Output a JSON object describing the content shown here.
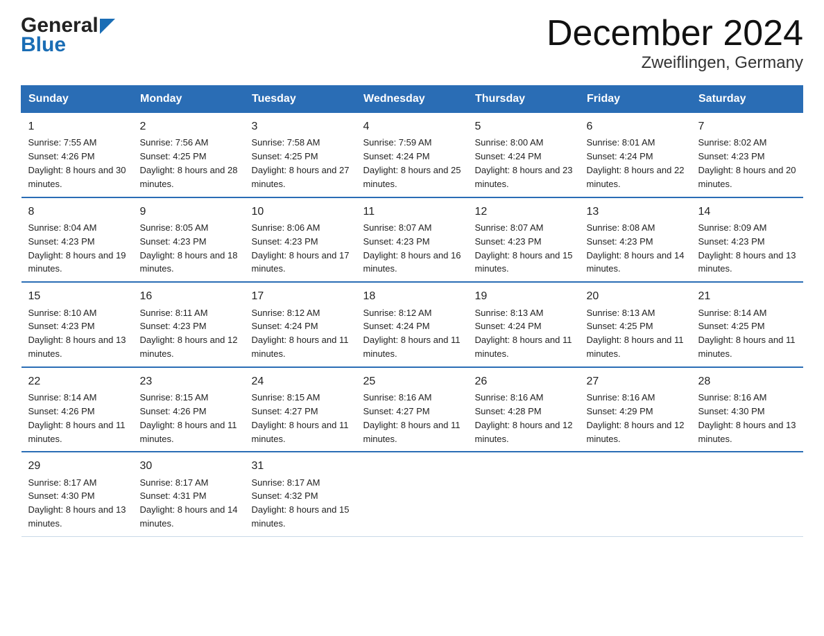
{
  "header": {
    "logo_general": "General",
    "logo_blue": "Blue",
    "title": "December 2024",
    "subtitle": "Zweiflingen, Germany"
  },
  "weekdays": [
    "Sunday",
    "Monday",
    "Tuesday",
    "Wednesday",
    "Thursday",
    "Friday",
    "Saturday"
  ],
  "weeks": [
    [
      {
        "day": "1",
        "sunrise": "7:55 AM",
        "sunset": "4:26 PM",
        "daylight": "8 hours and 30 minutes."
      },
      {
        "day": "2",
        "sunrise": "7:56 AM",
        "sunset": "4:25 PM",
        "daylight": "8 hours and 28 minutes."
      },
      {
        "day": "3",
        "sunrise": "7:58 AM",
        "sunset": "4:25 PM",
        "daylight": "8 hours and 27 minutes."
      },
      {
        "day": "4",
        "sunrise": "7:59 AM",
        "sunset": "4:24 PM",
        "daylight": "8 hours and 25 minutes."
      },
      {
        "day": "5",
        "sunrise": "8:00 AM",
        "sunset": "4:24 PM",
        "daylight": "8 hours and 23 minutes."
      },
      {
        "day": "6",
        "sunrise": "8:01 AM",
        "sunset": "4:24 PM",
        "daylight": "8 hours and 22 minutes."
      },
      {
        "day": "7",
        "sunrise": "8:02 AM",
        "sunset": "4:23 PM",
        "daylight": "8 hours and 20 minutes."
      }
    ],
    [
      {
        "day": "8",
        "sunrise": "8:04 AM",
        "sunset": "4:23 PM",
        "daylight": "8 hours and 19 minutes."
      },
      {
        "day": "9",
        "sunrise": "8:05 AM",
        "sunset": "4:23 PM",
        "daylight": "8 hours and 18 minutes."
      },
      {
        "day": "10",
        "sunrise": "8:06 AM",
        "sunset": "4:23 PM",
        "daylight": "8 hours and 17 minutes."
      },
      {
        "day": "11",
        "sunrise": "8:07 AM",
        "sunset": "4:23 PM",
        "daylight": "8 hours and 16 minutes."
      },
      {
        "day": "12",
        "sunrise": "8:07 AM",
        "sunset": "4:23 PM",
        "daylight": "8 hours and 15 minutes."
      },
      {
        "day": "13",
        "sunrise": "8:08 AM",
        "sunset": "4:23 PM",
        "daylight": "8 hours and 14 minutes."
      },
      {
        "day": "14",
        "sunrise": "8:09 AM",
        "sunset": "4:23 PM",
        "daylight": "8 hours and 13 minutes."
      }
    ],
    [
      {
        "day": "15",
        "sunrise": "8:10 AM",
        "sunset": "4:23 PM",
        "daylight": "8 hours and 13 minutes."
      },
      {
        "day": "16",
        "sunrise": "8:11 AM",
        "sunset": "4:23 PM",
        "daylight": "8 hours and 12 minutes."
      },
      {
        "day": "17",
        "sunrise": "8:12 AM",
        "sunset": "4:24 PM",
        "daylight": "8 hours and 11 minutes."
      },
      {
        "day": "18",
        "sunrise": "8:12 AM",
        "sunset": "4:24 PM",
        "daylight": "8 hours and 11 minutes."
      },
      {
        "day": "19",
        "sunrise": "8:13 AM",
        "sunset": "4:24 PM",
        "daylight": "8 hours and 11 minutes."
      },
      {
        "day": "20",
        "sunrise": "8:13 AM",
        "sunset": "4:25 PM",
        "daylight": "8 hours and 11 minutes."
      },
      {
        "day": "21",
        "sunrise": "8:14 AM",
        "sunset": "4:25 PM",
        "daylight": "8 hours and 11 minutes."
      }
    ],
    [
      {
        "day": "22",
        "sunrise": "8:14 AM",
        "sunset": "4:26 PM",
        "daylight": "8 hours and 11 minutes."
      },
      {
        "day": "23",
        "sunrise": "8:15 AM",
        "sunset": "4:26 PM",
        "daylight": "8 hours and 11 minutes."
      },
      {
        "day": "24",
        "sunrise": "8:15 AM",
        "sunset": "4:27 PM",
        "daylight": "8 hours and 11 minutes."
      },
      {
        "day": "25",
        "sunrise": "8:16 AM",
        "sunset": "4:27 PM",
        "daylight": "8 hours and 11 minutes."
      },
      {
        "day": "26",
        "sunrise": "8:16 AM",
        "sunset": "4:28 PM",
        "daylight": "8 hours and 12 minutes."
      },
      {
        "day": "27",
        "sunrise": "8:16 AM",
        "sunset": "4:29 PM",
        "daylight": "8 hours and 12 minutes."
      },
      {
        "day": "28",
        "sunrise": "8:16 AM",
        "sunset": "4:30 PM",
        "daylight": "8 hours and 13 minutes."
      }
    ],
    [
      {
        "day": "29",
        "sunrise": "8:17 AM",
        "sunset": "4:30 PM",
        "daylight": "8 hours and 13 minutes."
      },
      {
        "day": "30",
        "sunrise": "8:17 AM",
        "sunset": "4:31 PM",
        "daylight": "8 hours and 14 minutes."
      },
      {
        "day": "31",
        "sunrise": "8:17 AM",
        "sunset": "4:32 PM",
        "daylight": "8 hours and 15 minutes."
      },
      null,
      null,
      null,
      null
    ]
  ]
}
